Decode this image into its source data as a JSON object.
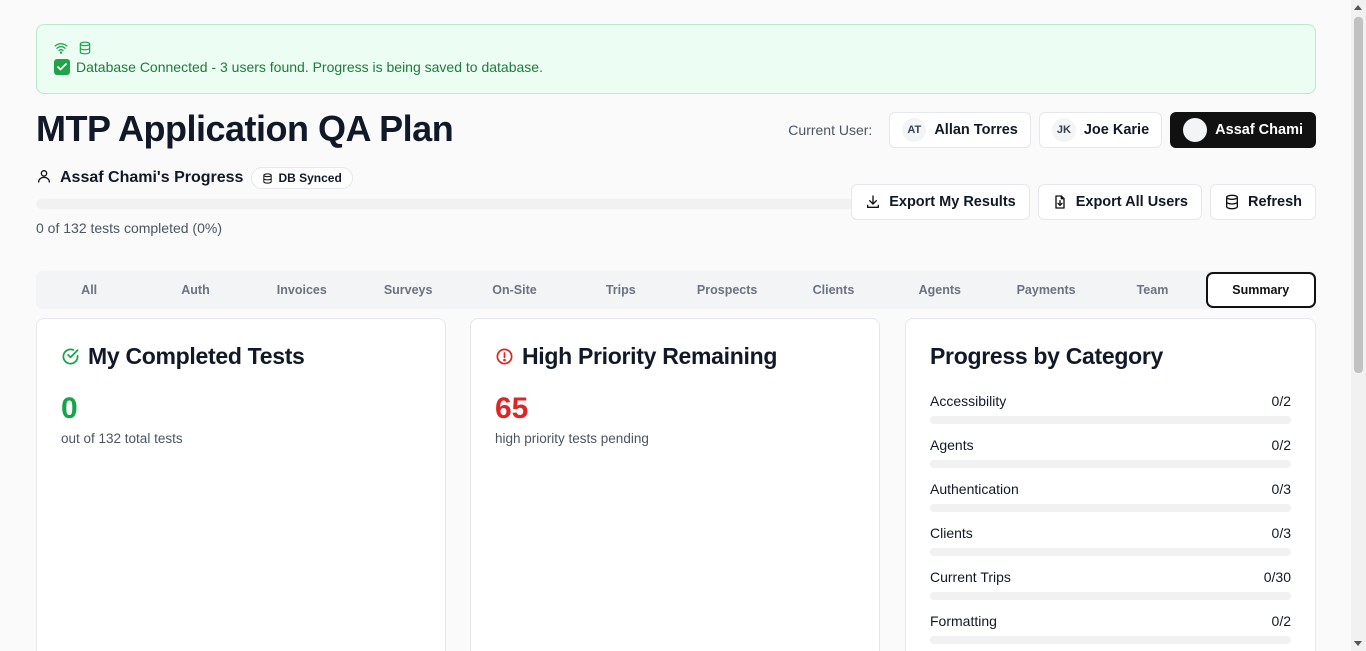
{
  "banner": {
    "icons": [
      "wifi-icon",
      "database-icon"
    ],
    "message": "Database Connected - 3 users found. Progress is being saved to database."
  },
  "header": {
    "title": "MTP Application QA Plan",
    "current_user_label": "Current User:",
    "users": [
      {
        "initials": "AT",
        "name": "Allan Torres",
        "active": false
      },
      {
        "initials": "JK",
        "name": "Joe Karie",
        "active": false
      },
      {
        "initials": "",
        "name": "Assaf Chami",
        "active": true
      }
    ]
  },
  "progress": {
    "title": "Assaf Chami's Progress",
    "badge": "DB Synced",
    "fraction": 0,
    "text": "0 of 132 tests completed (0%)"
  },
  "actions": {
    "export_mine": "Export My Results",
    "export_all": "Export All Users",
    "refresh": "Refresh"
  },
  "tabs": [
    "All",
    "Auth",
    "Invoices",
    "Surveys",
    "On-Site",
    "Trips",
    "Prospects",
    "Clients",
    "Agents",
    "Payments",
    "Team",
    "Summary"
  ],
  "active_tab": "Summary",
  "cards": {
    "completed": {
      "title": "My Completed Tests",
      "value": "0",
      "sub": "out of 132 total tests",
      "color": "#16a34a"
    },
    "priority": {
      "title": "High Priority Remaining",
      "value": "65",
      "sub": "high priority tests pending",
      "color": "#dc2626"
    },
    "category": {
      "title": "Progress by Category",
      "items": [
        {
          "name": "Accessibility",
          "count": "0/2",
          "fraction": 0
        },
        {
          "name": "Agents",
          "count": "0/2",
          "fraction": 0
        },
        {
          "name": "Authentication",
          "count": "0/3",
          "fraction": 0
        },
        {
          "name": "Clients",
          "count": "0/3",
          "fraction": 0
        },
        {
          "name": "Current Trips",
          "count": "0/30",
          "fraction": 0
        },
        {
          "name": "Formatting",
          "count": "0/2",
          "fraction": 0
        }
      ]
    }
  }
}
